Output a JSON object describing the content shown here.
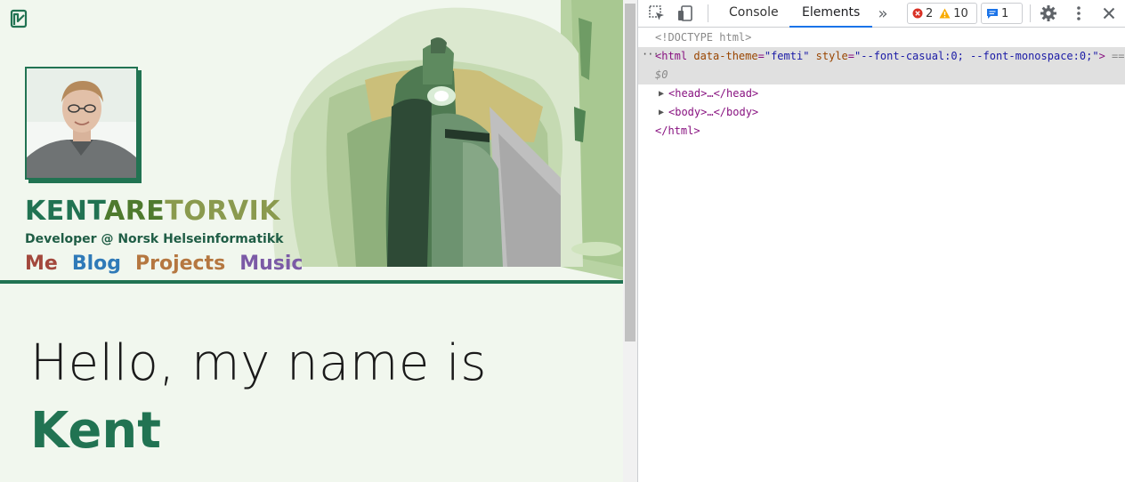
{
  "site": {
    "title_parts": [
      "KENT",
      "ARE",
      "TORVIK"
    ],
    "subtitle": "Developer @ Norsk Helseinformatikk",
    "nav": [
      {
        "label": "Me",
        "color": "#a3483c"
      },
      {
        "label": "Blog",
        "color": "#2f7ab8"
      },
      {
        "label": "Projects",
        "color": "#b57740"
      },
      {
        "label": "Music",
        "color": "#7b5aa6"
      }
    ],
    "greeting": "Hello, my name is",
    "name": "Kent",
    "accent_color": "#217352"
  },
  "devtools": {
    "tabs": [
      {
        "label": "Console",
        "active": false
      },
      {
        "label": "Elements",
        "active": true
      }
    ],
    "more_tabs_glyph": "»",
    "errors": "2",
    "warnings": "10",
    "messages": "1",
    "dom": {
      "doctype": "<!DOCTYPE html>",
      "html_open_tag": "<html",
      "html_attr1_name": "data-theme",
      "html_attr1_value": "\"femti\"",
      "html_attr2_name": "style",
      "html_attr2_value": "\"--font-casual:0; --font-monospace:0;\"",
      "html_open_close": ">",
      "selected_marker": "== $0",
      "head": "<head>…</head>",
      "body": "<body>…</body>",
      "html_close": "</html>"
    }
  }
}
